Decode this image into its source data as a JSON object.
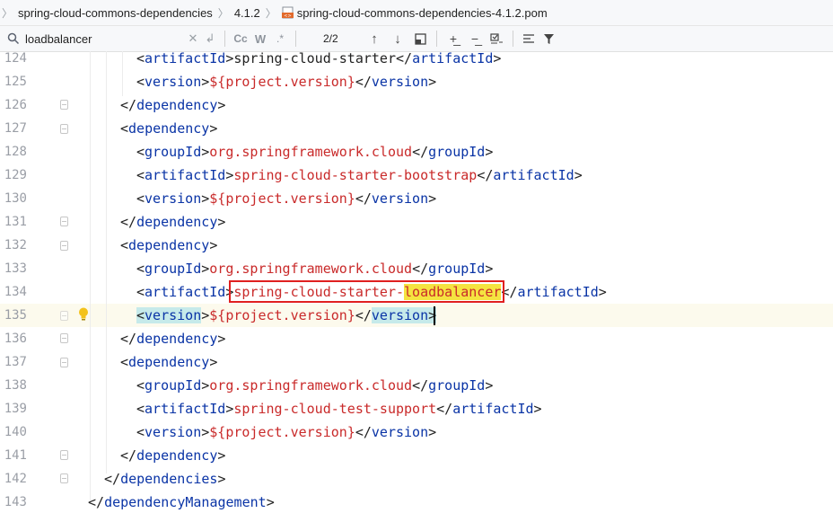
{
  "breadcrumb": {
    "items": [
      "spring-cloud-commons-dependencies",
      "4.1.2",
      "spring-cloud-commons-dependencies-4.1.2.pom"
    ]
  },
  "search": {
    "query": "loadbalancer",
    "match_count": "2/2",
    "match_case_label": "Cc",
    "words_label": "W",
    "regex_label": ".*"
  },
  "code_lines": [
    {
      "num": "124"
    },
    {
      "num": "125"
    },
    {
      "num": "126"
    },
    {
      "num": "127"
    },
    {
      "num": "128"
    },
    {
      "num": "129"
    },
    {
      "num": "130"
    },
    {
      "num": "131"
    },
    {
      "num": "132"
    },
    {
      "num": "133"
    },
    {
      "num": "134"
    },
    {
      "num": "135"
    },
    {
      "num": "136"
    },
    {
      "num": "137"
    },
    {
      "num": "138"
    },
    {
      "num": "139"
    },
    {
      "num": "140"
    },
    {
      "num": "141"
    },
    {
      "num": "142"
    },
    {
      "num": "143"
    }
  ],
  "tags": {
    "artifactId": "artifactId",
    "version": "version",
    "dependency": "dependency",
    "groupId": "groupId",
    "dependencies": "dependencies",
    "dependencyManagement": "dependencyManagement"
  },
  "values": {
    "starter": "spring-cloud-starter",
    "project_version": "${project.version}",
    "group_cloud": "org.springframework.cloud",
    "starter_bootstrap": "spring-cloud-starter-bootstrap",
    "starter_lb_prefix": "spring-cloud-starter-",
    "lb_match": "loadbalancer",
    "test_support": "spring-cloud-test-support"
  },
  "colors": {
    "tag": "#0a34a6",
    "value": "#c92a2a",
    "search_highlight": "#f5e340",
    "tag_match": "#c6eaea",
    "current_line": "#fcfaed"
  }
}
